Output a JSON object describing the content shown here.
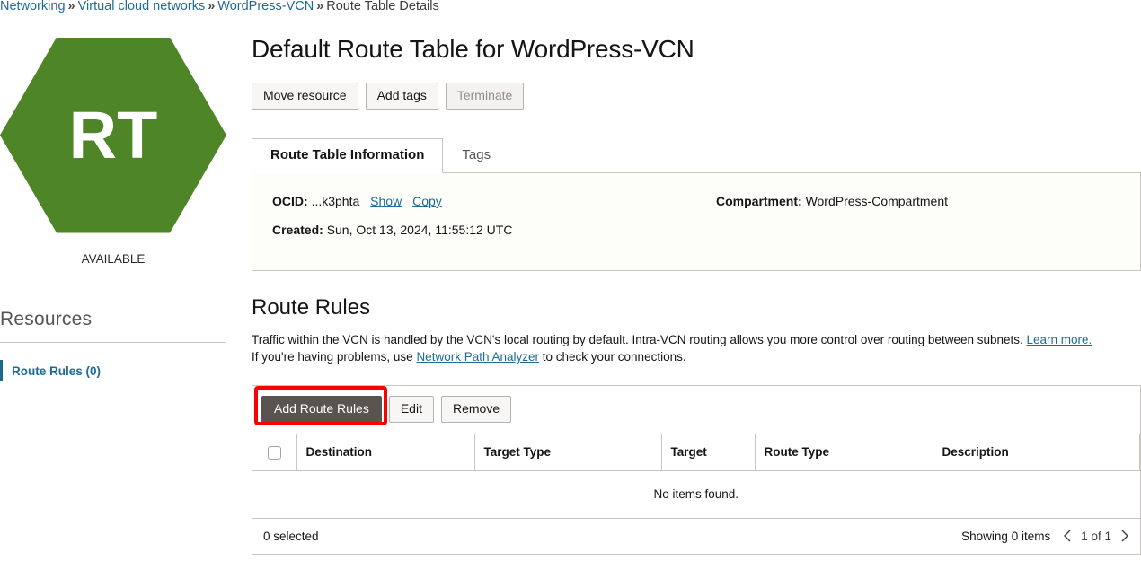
{
  "breadcrumb": {
    "items": [
      {
        "label": "Networking",
        "link": true
      },
      {
        "label": "Virtual cloud networks",
        "link": true
      },
      {
        "label": "WordPress-VCN",
        "link": true
      },
      {
        "label": "Route Table Details",
        "link": false
      }
    ],
    "separator": "»"
  },
  "resource_badge": {
    "initials": "RT",
    "status": "AVAILABLE",
    "color": "#4e8526"
  },
  "sidebar": {
    "title": "Resources",
    "items": [
      {
        "label": "Route Rules (0)",
        "active": true,
        "accent": "#1a6a8c"
      }
    ]
  },
  "header": {
    "title": "Default Route Table for WordPress-VCN",
    "actions": [
      {
        "label": "Move resource",
        "disabled": false
      },
      {
        "label": "Add tags",
        "disabled": false
      },
      {
        "label": "Terminate",
        "disabled": true
      }
    ]
  },
  "tabs": [
    {
      "label": "Route Table Information",
      "active": true
    },
    {
      "label": "Tags",
      "active": false
    }
  ],
  "info": {
    "ocid_label": "OCID:",
    "ocid_value": "...k3phta",
    "show_link": "Show",
    "copy_link": "Copy",
    "created_label": "Created:",
    "created_value": "Sun, Oct 13, 2024, 11:55:12 UTC",
    "compartment_label": "Compartment:",
    "compartment_value": "WordPress-Compartment"
  },
  "route_rules": {
    "title": "Route Rules",
    "description_line1_pre": "Traffic within the VCN is handled by the VCN's local routing by default. Intra-VCN routing allows you more control over routing between subnets. ",
    "description_link1": "Learn more.",
    "description_line2_pre": "If you're having problems, use ",
    "description_link2": "Network Path Analyzer",
    "description_line2_post": " to check your connections.",
    "toolbar": [
      {
        "label": "Add Route Rules",
        "primary": true,
        "highlighted": true
      },
      {
        "label": "Edit",
        "primary": false
      },
      {
        "label": "Remove",
        "primary": false
      }
    ],
    "columns": [
      "Destination",
      "Target Type",
      "Target",
      "Route Type",
      "Description"
    ],
    "empty_text": "No items found.",
    "selected_text": "0 selected",
    "showing_text": "Showing 0 items",
    "page_text": "1 of 1",
    "prev_icon": "chevron-left-icon",
    "next_icon": "chevron-right-icon",
    "annotation_color": "#fb0000"
  }
}
